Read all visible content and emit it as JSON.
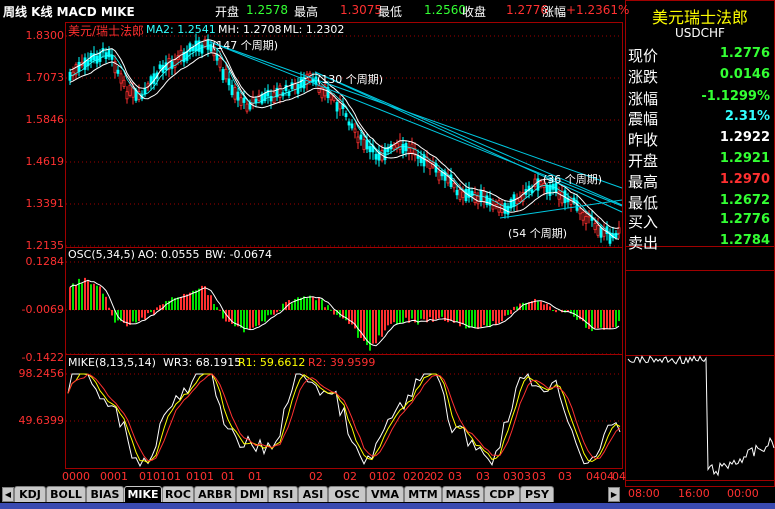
{
  "header": {
    "title": "周线 K线 MACD MIKE",
    "open_label": "开盘",
    "open_value": "1.2578",
    "high_label": "最高",
    "high_value": "1.3075",
    "low_label": "最低",
    "low_value": "1.2560",
    "close_label": "收盘",
    "close_value": "1.2776",
    "change_label": "涨幅",
    "change_value": "+1.2361%"
  },
  "main_pane": {
    "symbol_name": "美元/瑞士法郎",
    "ma2": "MA2: 1.2541",
    "mh": "MH: 1.2708",
    "ml": "ML: 1.2302",
    "y_labels": [
      "1.8300",
      "1.7073",
      "1.5846",
      "1.4619",
      "1.3391",
      "1.2135"
    ],
    "annotations": [
      "(147 个周期)",
      "(130 个周期)",
      "(36 个周期)",
      "(54 个周期)"
    ]
  },
  "osc_pane": {
    "title": "OSC(5,34,5)",
    "ao": "AO: 0.0555",
    "bw": "BW: -0.0674",
    "y_labels": [
      "0.1284",
      "-0.0069",
      "-0.1422"
    ]
  },
  "mike_pane": {
    "title": "MIKE(8,13,5,14)",
    "wr3": "WR3: 68.1915",
    "r1": "R1: 59.6612",
    "r2": "R2: 39.9599",
    "y_labels": [
      "98.2456",
      "49.6399"
    ]
  },
  "x_axis": [
    "0000",
    "0001",
    "0101",
    "01",
    "0101",
    "01",
    "01",
    "02",
    "02",
    "01",
    "02",
    "0202",
    "02",
    "03",
    "03",
    "0303",
    "03",
    "03",
    "0404",
    "04"
  ],
  "quote_panel": {
    "title": "美元瑞士法郎",
    "code": "USDCHF",
    "rows": [
      {
        "label": "现价",
        "value": "1.2776",
        "color": "#33ff33"
      },
      {
        "label": "涨跌",
        "value": "0.0146",
        "color": "#33ff33"
      },
      {
        "label": "涨幅",
        "value": "-1.1299%",
        "color": "#33ff33"
      },
      {
        "label": "震幅",
        "value": "2.31%",
        "color": "#33ffff"
      },
      {
        "label": "昨收",
        "value": "1.2922",
        "color": "#ffffff"
      },
      {
        "label": "开盘",
        "value": "1.2921",
        "color": "#33ff33"
      },
      {
        "label": "最高",
        "value": "1.2970",
        "color": "#ff3030"
      },
      {
        "label": "最低",
        "value": "1.2672",
        "color": "#33ff33"
      },
      {
        "label": "买入",
        "value": "1.2776",
        "color": "#33ff33"
      },
      {
        "label": "卖出",
        "value": "1.2784",
        "color": "#33ff33"
      }
    ],
    "time_labels": [
      "08:00",
      "16:00",
      "00:00"
    ]
  },
  "tabs": [
    "KDJ",
    "BOLL",
    "BIAS",
    "MIKE",
    "ROC",
    "ARBR",
    "DMI",
    "RSI",
    "ASI",
    "OSC",
    "VMA",
    "MTM",
    "MASS",
    "CDP",
    "PSY"
  ],
  "active_tab": "MIKE",
  "colors": {
    "up": "#ff3030",
    "down": "#00ffff",
    "green_bar": "#00e000",
    "grid": "#a00000",
    "trendline": "#00c8e0",
    "wr": "#ffff00",
    "r2": "#ff3030"
  }
}
